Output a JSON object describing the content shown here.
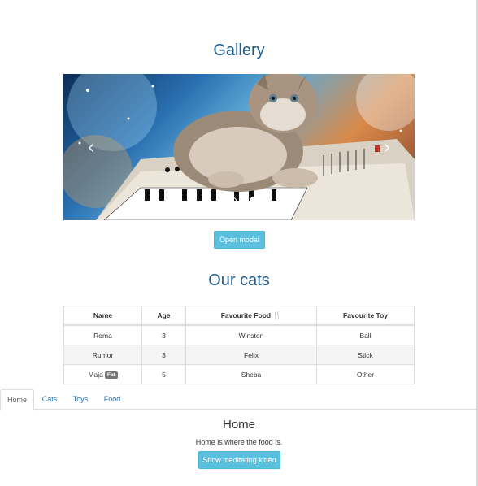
{
  "gallery": {
    "title": "Gallery",
    "carousel": {
      "prev_icon": "chevron-left-icon",
      "next_icon": "chevron-right-icon",
      "indicator_count": 4,
      "active_index": 3
    },
    "open_modal_label": "Open modal"
  },
  "cats": {
    "title": "Our cats",
    "columns": [
      "Name",
      "Age",
      "Favourite Food",
      "Favourite Toy"
    ],
    "food_icon": "cutlery-icon",
    "rows": [
      {
        "name": "Roma",
        "age": "3",
        "food": "Winston",
        "toy": "Ball"
      },
      {
        "name": "Rumor",
        "age": "3",
        "food": "Felix",
        "toy": "Stick"
      },
      {
        "name": "Maja",
        "badge": "Fat",
        "age": "5",
        "food": "Sheba",
        "toy": "Other"
      }
    ]
  },
  "tabs": {
    "items": [
      "Home",
      "Cats",
      "Toys",
      "Food"
    ],
    "active": "Home"
  },
  "home": {
    "heading": "Home",
    "text": "Home is where the food is.",
    "button_label": "Show meditating kitten"
  },
  "colors": {
    "heading": "#1f5f8f",
    "link": "#2a74b0",
    "info_button": "#5bc0de",
    "badge": "#777777"
  }
}
